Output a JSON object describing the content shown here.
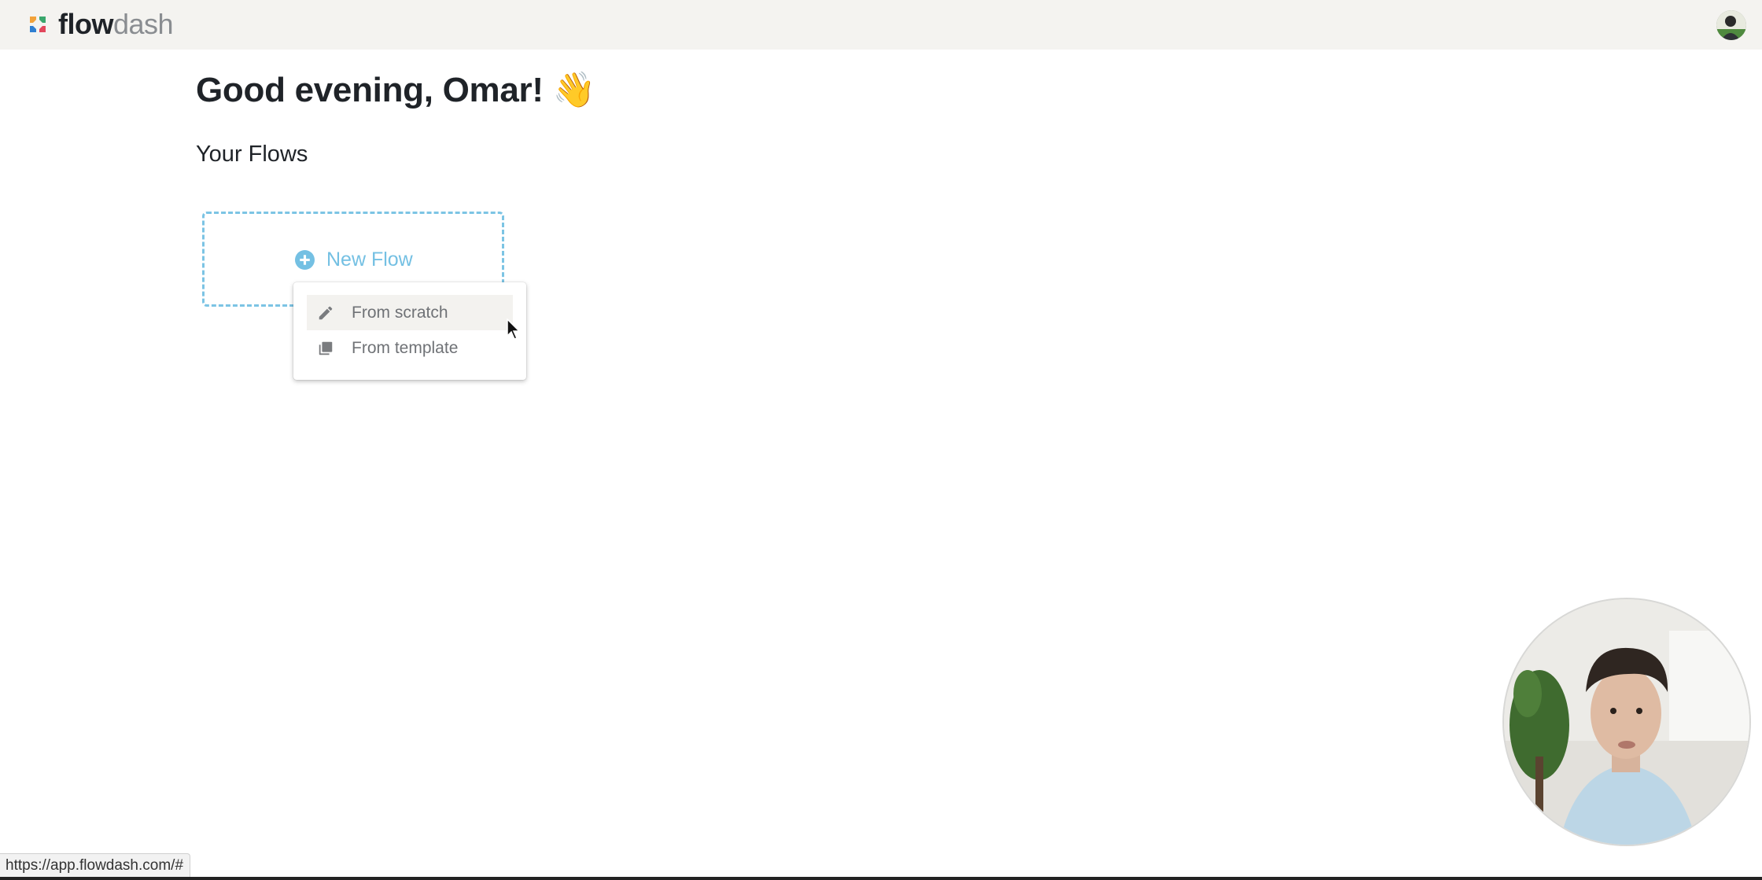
{
  "app": {
    "logo_bold": "flow",
    "logo_light": "dash"
  },
  "header": {
    "avatar_icon": "user-avatar"
  },
  "main": {
    "greeting": "Good evening, Omar!",
    "greeting_emoji": "👋",
    "section_title": "Your Flows",
    "new_flow_label": "New Flow"
  },
  "new_flow_menu": {
    "items": [
      {
        "label": "From scratch",
        "icon": "pencil-icon",
        "highlighted": true
      },
      {
        "label": "From template",
        "icon": "copy-icon",
        "highlighted": false
      }
    ]
  },
  "status_bar": {
    "url": "https://app.flowdash.com/#"
  },
  "colors": {
    "accent_blue": "#74c0e3",
    "topbar_bg": "#f4f3f0"
  }
}
